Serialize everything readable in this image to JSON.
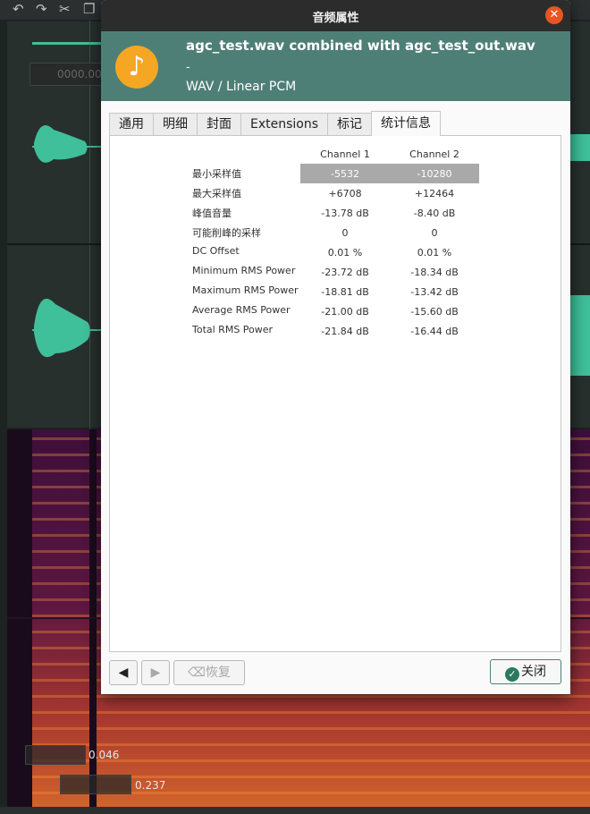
{
  "background": {
    "toolbar_icons": [
      "undo-icon",
      "redo-icon",
      "cut-icon",
      "copy-icon"
    ],
    "time_display_top": "0000.00",
    "label_a": "0.046",
    "label_b": "0.237"
  },
  "dialog": {
    "title": "音频属性",
    "file_name": "agc_test.wav combined with agc_test_out.wav",
    "dash": "-",
    "format": "WAV / Linear PCM",
    "tabs": [
      "通用",
      "明细",
      "封面",
      "Extensions",
      "标记",
      "统计信息"
    ],
    "active_tab": "统计信息",
    "stats": {
      "col_headers": [
        "Channel 1",
        "Channel 2"
      ],
      "rows": [
        {
          "label": "最小采样值",
          "ch1": "-5532",
          "ch2": "-10280",
          "selected": true
        },
        {
          "label": "最大采样值",
          "ch1": "+6708",
          "ch2": "+12464"
        },
        {
          "label": "峰值音量",
          "ch1": "-13.78 dB",
          "ch2": "-8.40 dB"
        },
        {
          "label": "可能削峰的采样",
          "ch1": "0",
          "ch2": "0"
        },
        {
          "label": "DC Offset",
          "ch1": "0.01 %",
          "ch2": "0.01 %"
        },
        {
          "label": "Minimum RMS Power",
          "ch1": "-23.72 dB",
          "ch2": "-18.34 dB"
        },
        {
          "label": "Maximum RMS Power",
          "ch1": "-18.81 dB",
          "ch2": "-13.42 dB"
        },
        {
          "label": "Average RMS Power",
          "ch1": "-21.00 dB",
          "ch2": "-15.60 dB"
        },
        {
          "label": "Total RMS Power",
          "ch1": "-21.84 dB",
          "ch2": "-16.44 dB"
        }
      ]
    },
    "buttons": {
      "prev": "◀",
      "next": "▶",
      "restore": "⌫恢复",
      "close": "关闭"
    }
  },
  "colors": {
    "header_bg": "#4e7f76",
    "accent_close": "#e95420",
    "selection": "#a9a9a9",
    "waveform": "#3fbf9a"
  }
}
